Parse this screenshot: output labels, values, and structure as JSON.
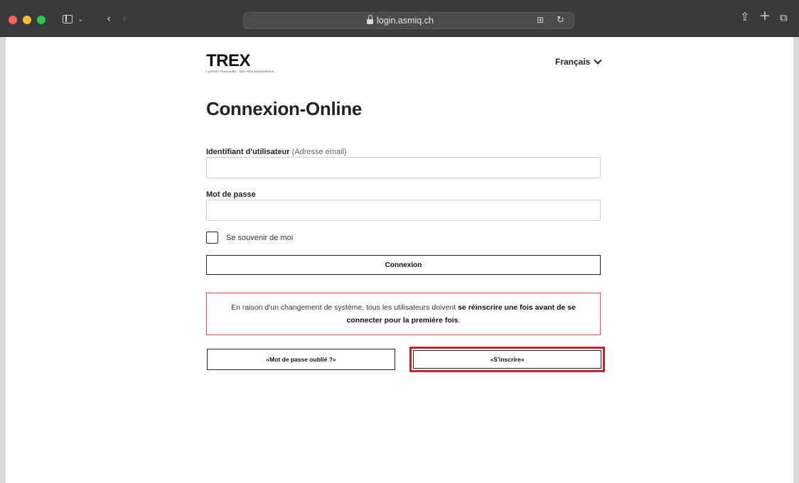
{
  "browser": {
    "url": "login.asmiq.ch",
    "icons": {
      "sidebar": "sidebar-icon",
      "back": "chevron-left-icon",
      "forward": "chevron-right-icon",
      "lock": "lock-icon",
      "translate": "translate-icon",
      "reload": "reload-icon",
      "share": "share-icon",
      "new_tab": "plus-icon",
      "tabs": "tabs-overview-icon"
    }
  },
  "header": {
    "logo_text": "TREX",
    "logo_tagline": "L'EXPERT FIDUCIAIRE – DER TREUHANDEXPERTE",
    "language": "Français"
  },
  "main": {
    "title": "Connexion-Online",
    "username_label": "Identifiant d'utilisateur",
    "username_hint": "(Adresse email)",
    "username_value": "",
    "password_label": "Mot de passe",
    "password_value": "",
    "remember_label": "Se souvenir de moi",
    "remember_checked": false,
    "login_button": "Connexion",
    "notice": {
      "text_start": "En raison d'un changement de système, tous les utilisateurs doivent ",
      "text_bold": "se réinscrire une fois avant de se connecter pour la première fois",
      "text_end": "."
    },
    "forgot_button": "«Mot de passe oublié ?»",
    "register_button": "«S'inscrire»"
  },
  "colors": {
    "notice_border": "#e05050",
    "highlight": "#c0262d"
  }
}
